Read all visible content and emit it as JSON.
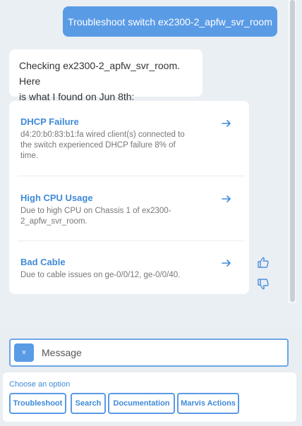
{
  "conversation": {
    "user_message": "Troubleshoot switch ex2300-2_apfw_svr_room",
    "bot_message_line1": "Checking ex2300-2_apfw_svr_room. Here",
    "bot_message_line2": "is what I found on Jun 8th:"
  },
  "results": [
    {
      "title": "DHCP Failure",
      "desc_line1": "d4:20:b0:83:b1:fa wired client(s) connected to",
      "desc_line2": "the switch experienced DHCP failure 8% of",
      "desc_line3": "time."
    },
    {
      "title": "High CPU Usage",
      "desc_line1": "Due to high CPU on Chassis 1 of ex2300-",
      "desc_line2": "2_apfw_svr_room."
    },
    {
      "title": "Bad Cable",
      "desc_line1": "Due to cable issues on ge-0/0/12, ge-0/0/40."
    }
  ],
  "feedback": {
    "thumbs_up_icon": "thumbs-up-icon",
    "thumbs_down_icon": "thumbs-down-icon"
  },
  "composer": {
    "clear_label": "×",
    "placeholder": "Message",
    "value": ""
  },
  "options": {
    "label": "Choose an option",
    "buttons": [
      "Troubleshoot",
      "Search",
      "Documentation",
      "Marvis Actions"
    ]
  },
  "colors": {
    "accent": "#5a9be6",
    "link": "#3f8ad8",
    "background": "#eaeff4"
  }
}
